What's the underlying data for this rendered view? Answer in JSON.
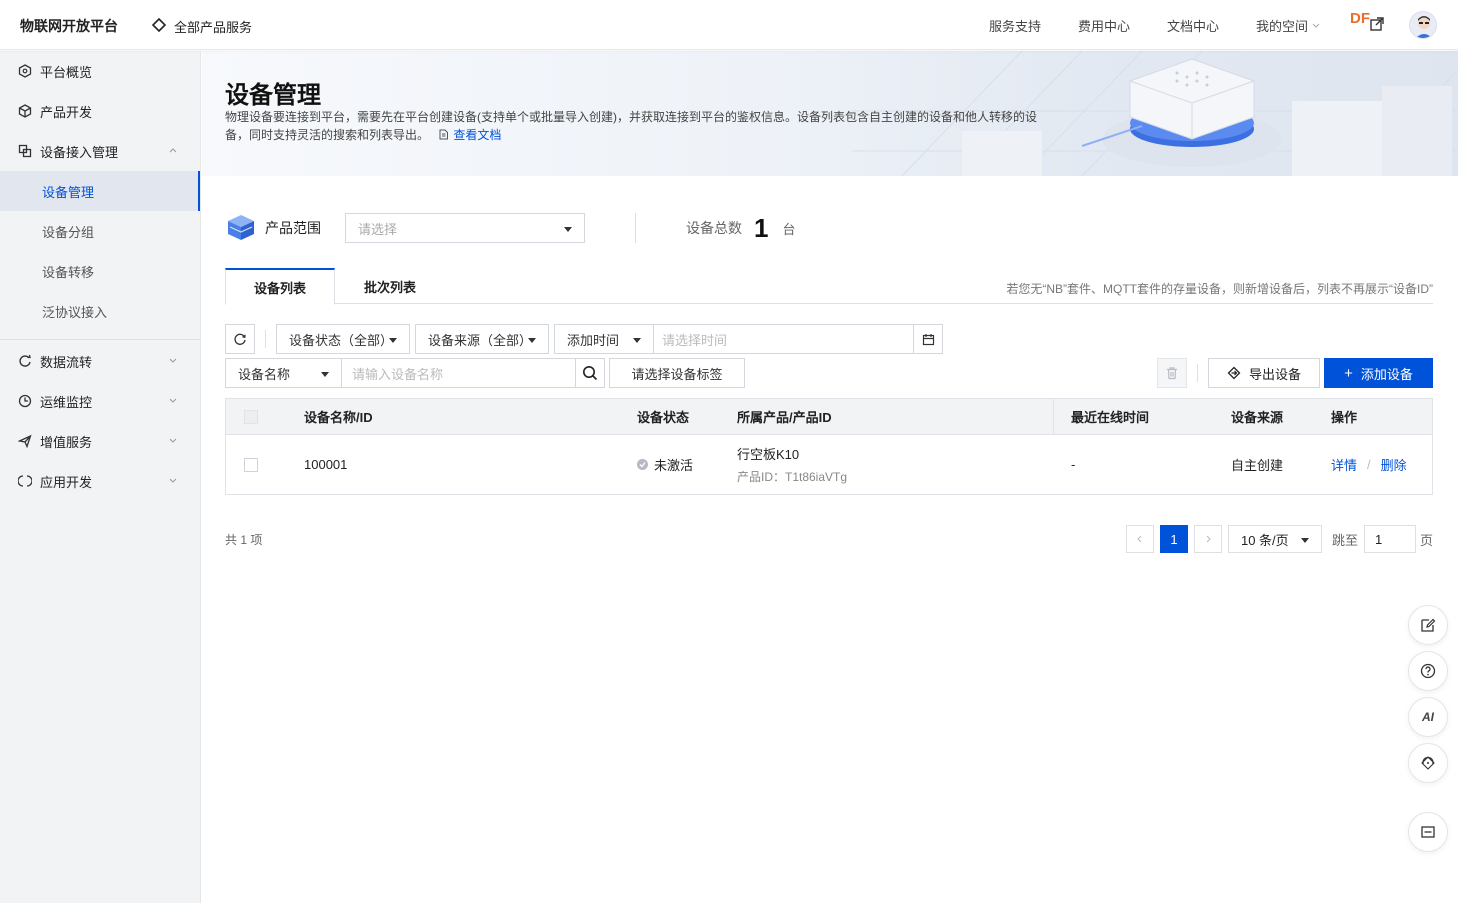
{
  "topbar": {
    "brand": "物联网开放平台",
    "all_products": "全部产品服务",
    "nav": [
      "服务支持",
      "费用中心",
      "文档中心"
    ],
    "my_space": "我的空间",
    "df_badge": "DF"
  },
  "sidebar": {
    "items": [
      {
        "label": "平台概览",
        "icon": "overview-icon"
      },
      {
        "label": "产品开发",
        "icon": "cube-icon"
      },
      {
        "label": "设备接入管理",
        "icon": "device-access-icon"
      }
    ],
    "sub_items": [
      "设备管理",
      "设备分组",
      "设备转移",
      "泛协议接入"
    ],
    "active_sub": "设备管理",
    "lower_items": [
      {
        "label": "数据流转",
        "icon": "data-flow-icon"
      },
      {
        "label": "运维监控",
        "icon": "monitor-icon"
      },
      {
        "label": "增值服务",
        "icon": "plane-icon"
      },
      {
        "label": "应用开发",
        "icon": "app-dev-icon"
      }
    ]
  },
  "banner": {
    "title": "设备管理",
    "description": "物理设备要连接到平台，需要先在平台创建设备(支持单个或批量导入创建)，并获取连接到平台的鉴权信息。设备列表包含自主创建的设备和他人转移的设备，同时支持灵活的搜索和列表导出。",
    "doc_link": "查看文档"
  },
  "product_range": {
    "label": "产品范围",
    "placeholder": "请选择",
    "total_label": "设备总数",
    "total_value": "1",
    "total_unit": "台"
  },
  "tabs": {
    "items": [
      "设备列表",
      "批次列表"
    ],
    "active": "设备列表",
    "note": "若您无“NB”套件、MQTT套件的存量设备，则新增设备后，列表不再展示“设备ID”"
  },
  "filters": {
    "status": "设备状态（全部）",
    "source": "设备来源（全部）",
    "time_field": "添加时间",
    "time_placeholder": "请选择时间",
    "name_field": "设备名称",
    "name_placeholder": "请输入设备名称",
    "tag_placeholder": "请选择设备标签",
    "export": "导出设备",
    "add": "添加设备"
  },
  "table": {
    "headers": [
      "设备名称/ID",
      "设备状态",
      "所属产品/产品ID",
      "最近在线时间",
      "设备来源",
      "操作"
    ],
    "rows": [
      {
        "name": "100001",
        "status": "未激活",
        "product": "行空板K10",
        "product_id": "产品ID：T1t86iaVTg",
        "last_online": "-",
        "source": "自主创建",
        "action_detail": "详情",
        "action_sep": "/",
        "action_delete": "删除"
      }
    ]
  },
  "pagination": {
    "total": "共 1 项",
    "current": "1",
    "page_size": "10 条/页",
    "jump_label": "跳至",
    "jump_value": "1",
    "page_unit": "页"
  },
  "float_tools": {
    "ai_label": "AI"
  },
  "colors": {
    "primary": "#0052d9",
    "sidebar_bg": "#f2f3f5",
    "df": "#e8702a"
  }
}
